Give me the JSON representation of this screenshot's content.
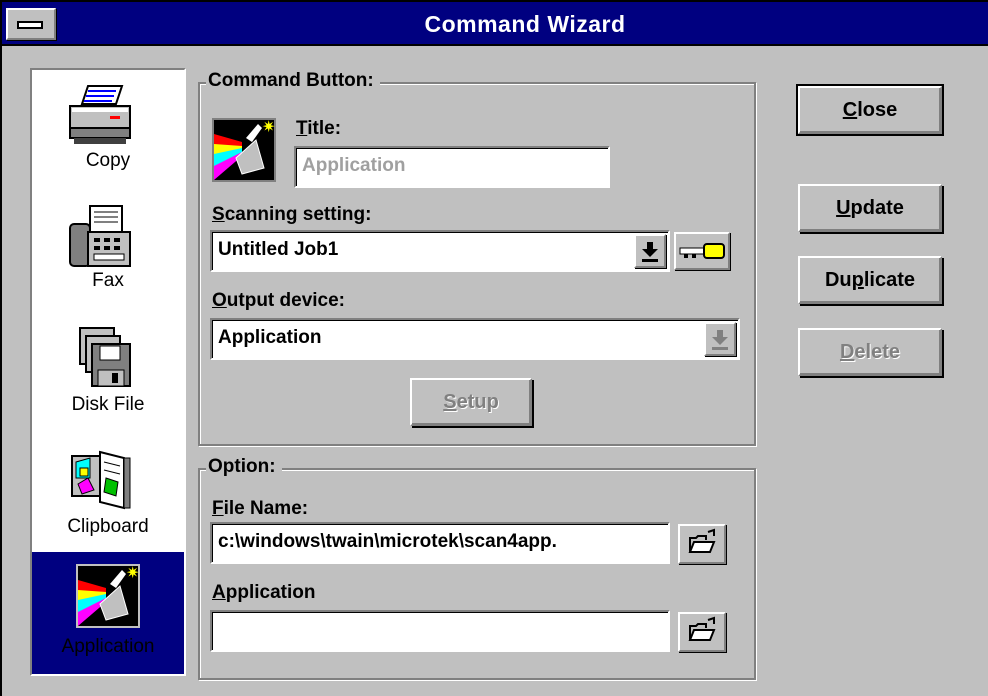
{
  "window": {
    "title": "Command Wizard"
  },
  "sidebar": {
    "items": [
      {
        "label": "Copy",
        "icon": "printer-icon"
      },
      {
        "label": "Fax",
        "icon": "fax-icon"
      },
      {
        "label": "Disk File",
        "icon": "floppy-disks-icon"
      },
      {
        "label": "Clipboard",
        "icon": "clipboard-icon"
      },
      {
        "label": "Application",
        "icon": "prism-icon",
        "selected": true
      }
    ]
  },
  "command_button": {
    "group_title": "Command Button:",
    "title_label_first": "T",
    "title_label_rest": "itle:",
    "title_value": "Application",
    "scanning_label_first": "S",
    "scanning_label_rest": "canning setting:",
    "scanning_value": "Untitled Job1",
    "output_label_first": "O",
    "output_label_rest": "utput device:",
    "output_value": "Application",
    "setup_first": "S",
    "setup_rest": "etup"
  },
  "option": {
    "group_title": "Option:",
    "filename_label_first": "F",
    "filename_label_rest": "ile Name:",
    "filename_value": "c:\\windows\\twain\\microtek\\scan4app.",
    "application_label_first": "A",
    "application_label_rest": "pplication",
    "application_value": ""
  },
  "actions": {
    "close_first": "C",
    "close_rest": "lose",
    "update_first": "U",
    "update_rest": "pdate",
    "duplicate_pre": "Du",
    "duplicate_u": "p",
    "duplicate_post": "licate",
    "delete_first": "D",
    "delete_rest": "elete"
  },
  "colors": {
    "titlebar": "#000080",
    "face": "#c0c0c0",
    "selection": "#000080"
  }
}
